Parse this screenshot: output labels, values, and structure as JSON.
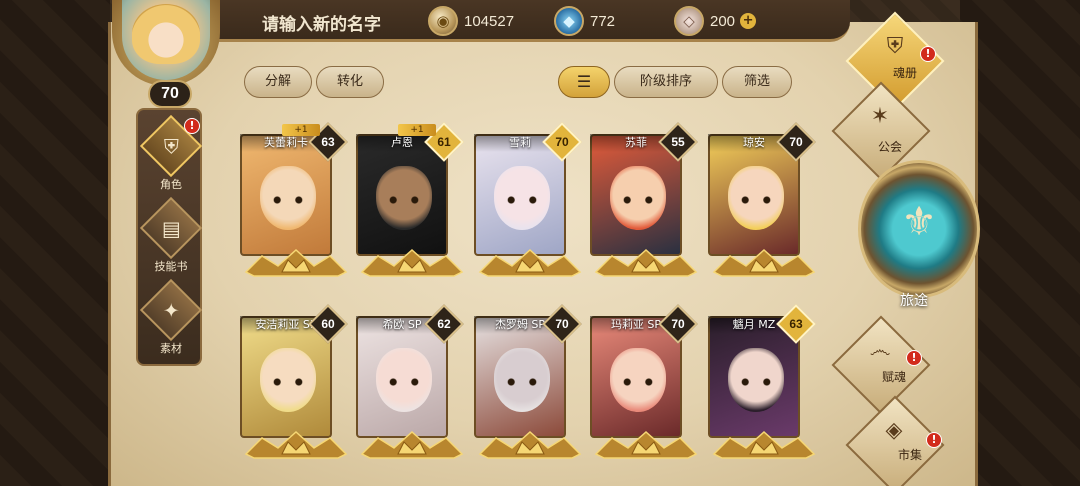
{
  "header": {
    "player_name": "请输入新的名字",
    "player_level": "70",
    "currencies": [
      {
        "icon": "gold-coin-icon",
        "value": "104527"
      },
      {
        "icon": "blue-crystal-icon",
        "value": "772"
      },
      {
        "icon": "gem-stone-icon",
        "value": "200",
        "plus": "+"
      }
    ]
  },
  "left_nav": [
    {
      "label": "角色",
      "icon": "helmet-icon",
      "active": true,
      "badge": "!"
    },
    {
      "label": "技能书",
      "icon": "skill-book-icon",
      "active": false
    },
    {
      "label": "素材",
      "icon": "material-icon",
      "active": false
    }
  ],
  "toolbar": {
    "decompose": "分解",
    "convert": "转化",
    "sort_icon": "sort-lines-icon",
    "sort_label": "阶级排序",
    "filter": "筛选"
  },
  "heroes": [
    {
      "name": "芙蕾莉卡",
      "level": "63",
      "plus": "+1",
      "level_style": "dark",
      "palette": [
        "#f0b870",
        "#f4d8b8",
        "#c17a3a"
      ]
    },
    {
      "name": "卢恩",
      "level": "61",
      "plus": "+1",
      "level_style": "gold",
      "palette": [
        "#2a2a2a",
        "#a87e5a",
        "#111"
      ]
    },
    {
      "name": "雪莉",
      "level": "70",
      "level_style": "gold",
      "palette": [
        "#e9e3ee",
        "#f6e3e6",
        "#9fa6c6"
      ]
    },
    {
      "name": "苏菲",
      "level": "55",
      "level_style": "dark",
      "palette": [
        "#e25b3a",
        "#f6cfae",
        "#2a3040"
      ]
    },
    {
      "name": "琼安",
      "level": "70",
      "level_style": "dark",
      "palette": [
        "#f3cf5a",
        "#f6d6bd",
        "#6a2a2a"
      ]
    },
    {
      "name": "安洁莉亚 SP",
      "level": "60",
      "level_style": "dark",
      "palette": [
        "#f0dc8a",
        "#f6dcc0",
        "#b08a3a"
      ]
    },
    {
      "name": "希欧 SP",
      "level": "62",
      "level_style": "dark",
      "palette": [
        "#ede3e2",
        "#f6dcd4",
        "#bba8a8"
      ]
    },
    {
      "name": "杰罗姆 SP",
      "level": "70",
      "level_style": "dark",
      "palette": [
        "#e6e1e1",
        "#d8cdd0",
        "#8c4a3a"
      ]
    },
    {
      "name": "玛莉亚 SP",
      "level": "70",
      "level_style": "dark",
      "palette": [
        "#e98a7a",
        "#f6d4c0",
        "#6b2a2a"
      ]
    },
    {
      "name": "魑月 MZ",
      "level": "63",
      "level_style": "gold",
      "palette": [
        "#2a1e2a",
        "#f0d6cc",
        "#6a3a6a"
      ]
    }
  ],
  "right_menu": [
    {
      "label": "魂册",
      "icon": "helmet-icon",
      "active": true,
      "badge": "!"
    },
    {
      "label": "公会",
      "icon": "guild-emblem-icon",
      "active": false
    },
    {
      "label": "旅途",
      "icon": "journey-emblem-icon",
      "active": false
    },
    {
      "label": "赋魂",
      "icon": "soul-swirl-icon",
      "active": false,
      "badge": "!"
    },
    {
      "label": "市集",
      "icon": "market-gem-icon",
      "active": false,
      "badge": "!"
    }
  ]
}
